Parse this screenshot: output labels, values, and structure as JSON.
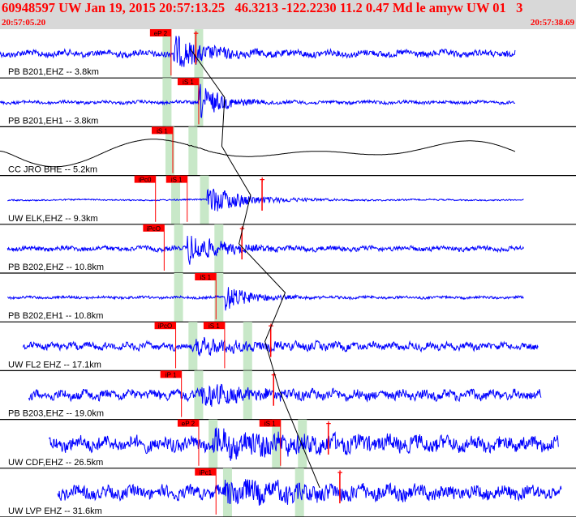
{
  "header": {
    "title": "60948597 UW Jan 19, 2015 20:57:13.25   46.3213 -122.2230 11.2 0.47 Md le amyw UW 01   3",
    "start_time": "20:57:05.20",
    "end_time": "20:57:38.69"
  },
  "colors": {
    "header_bg": "#d8d8d8",
    "header_text": "#ff0000",
    "trace": "#0000ff",
    "trace_alt": "#000000",
    "pick_box": "#ff0000",
    "window_band": "#c8e8c8"
  },
  "traces": [
    {
      "label": "PB B201,EHZ -- 3.8km",
      "color": "#0000ff",
      "range": [
        0.0,
        0.895
      ],
      "onset": 0.3,
      "amp": 4,
      "peak": 26,
      "decay": 0.05,
      "freq": 3,
      "slow": 0,
      "smooth": 0.1,
      "bands": [
        0.29,
        0.345
      ],
      "picks": [
        {
          "label": "eP 2",
          "x": 0.297,
          "amp": false
        },
        {
          "label": "",
          "x": 0.34,
          "amp": true
        }
      ]
    },
    {
      "label": "PB B201,EH1 -- 3.8km",
      "color": "#0000ff",
      "range": [
        0.0,
        0.895
      ],
      "onset": 0.345,
      "amp": 2,
      "peak": 28,
      "decay": 0.035,
      "freq": 3,
      "slow": 0,
      "smooth": 0.1,
      "bands": [
        0.29,
        0.345
      ],
      "picks": [
        {
          "label": "iS 1",
          "x": 0.345,
          "amp": false
        }
      ]
    },
    {
      "label": "CC JRO BHE -- 5.2km",
      "color": "#000000",
      "range": [
        0.0,
        0.895
      ],
      "onset": 0.325,
      "amp": 0.5,
      "peak": 6,
      "decay": 0.03,
      "freq": 0.5,
      "slow": 20,
      "smooth": 0.9,
      "bands": [
        0.295,
        0.335
      ],
      "picks": [
        {
          "label": "iS 1",
          "x": 0.3,
          "amp": false
        }
      ]
    },
    {
      "label": "UW ELK,EHZ -- 9.3km",
      "color": "#0000ff",
      "range": [
        0.013,
        0.91
      ],
      "onset": 0.36,
      "amp": 1,
      "peak": 24,
      "decay": 0.06,
      "freq": 1,
      "slow": 0,
      "smooth": 0.2,
      "bands": [
        0.305,
        0.355
      ],
      "picks": [
        {
          "label": "iPc0",
          "x": 0.27,
          "amp": false
        },
        {
          "label": "iS 1",
          "x": 0.325,
          "amp": false
        },
        {
          "label": "",
          "x": 0.455,
          "amp": true
        }
      ]
    },
    {
      "label": "PB B202,EHZ -- 10.8km",
      "color": "#0000ff",
      "range": [
        0.013,
        0.91
      ],
      "onset": 0.325,
      "amp": 3,
      "peak": 24,
      "decay": 0.05,
      "freq": 3,
      "slow": 0,
      "smooth": 0.12,
      "bands": [
        0.31,
        0.38
      ],
      "picks": [
        {
          "label": "iPcO",
          "x": 0.285,
          "amp": false
        },
        {
          "label": "",
          "x": 0.42,
          "amp": true
        }
      ]
    },
    {
      "label": "PB B202,EH1 -- 10.8km",
      "color": "#0000ff",
      "range": [
        0.013,
        0.91
      ],
      "onset": 0.39,
      "amp": 1.6,
      "peak": 20,
      "decay": 0.04,
      "freq": 3,
      "slow": 0,
      "smooth": 0.1,
      "bands": [
        0.31,
        0.38
      ],
      "picks": [
        {
          "label": "iS 1",
          "x": 0.375,
          "amp": false
        }
      ]
    },
    {
      "label": "UW FL2 EHZ -- 17.1km",
      "color": "#0000ff",
      "range": [
        0.04,
        0.935
      ],
      "onset": 0.34,
      "amp": 5,
      "peak": 16,
      "decay": 0.08,
      "freq": 6,
      "slow": 0,
      "smooth": 0.25,
      "bands": [
        0.335,
        0.43
      ],
      "picks": [
        {
          "label": "iPcO",
          "x": 0.305,
          "amp": false
        },
        {
          "label": "iS 1",
          "x": 0.39,
          "amp": false
        },
        {
          "label": "",
          "x": 0.47,
          "amp": true
        }
      ]
    },
    {
      "label": "PB B203,EHZ -- 19.0km",
      "color": "#0000ff",
      "range": [
        0.05,
        0.94
      ],
      "onset": 0.35,
      "amp": 6,
      "peak": 18,
      "decay": 0.07,
      "freq": 5,
      "slow": 0,
      "smooth": 0.12,
      "bands": [
        0.345,
        0.43
      ],
      "picks": [
        {
          "label": "iP 1",
          "x": 0.315,
          "amp": false
        },
        {
          "label": "",
          "x": 0.475,
          "amp": true
        }
      ]
    },
    {
      "label": "UW CDF,EHZ -- 26.5km",
      "color": "#0000ff",
      "range": [
        0.085,
        0.97
      ],
      "onset": 0.37,
      "amp": 9,
      "peak": 22,
      "decay": 0.15,
      "freq": 4,
      "slow": 0,
      "smooth": 0.15,
      "bands": [
        0.37,
        0.48,
        0.525
      ],
      "picks": [
        {
          "label": "eP 2",
          "x": 0.345,
          "amp": false
        },
        {
          "label": "iS 1",
          "x": 0.487,
          "amp": false
        },
        {
          "label": "",
          "x": 0.57,
          "amp": true
        }
      ]
    },
    {
      "label": "UW LVP EHZ -- 31.6km",
      "color": "#0000ff",
      "range": [
        0.1,
        0.975
      ],
      "onset": 0.39,
      "amp": 8,
      "peak": 20,
      "decay": 0.15,
      "freq": 4,
      "slow": 0,
      "smooth": 0.15,
      "bands": [
        0.395,
        0.52
      ],
      "picks": [
        {
          "label": "iPc1",
          "x": 0.375,
          "amp": false
        },
        {
          "label": "",
          "x": 0.59,
          "amp": true
        }
      ]
    }
  ]
}
